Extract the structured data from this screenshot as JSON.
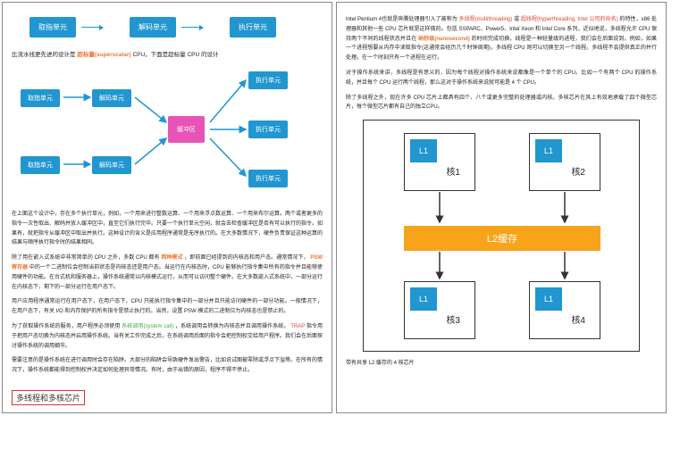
{
  "left": {
    "pipe": {
      "u1": "取指单元",
      "u2": "解码单元",
      "u3": "执行单元"
    },
    "cap1_a": "比流水线更先进的设计是",
    "cap1_b": "超标量(superscalar)",
    "cap1_c": " CPU。下面是超标量 CPU 的设计",
    "ss": {
      "fetch": "取指单元",
      "decode": "解码单元",
      "buffer": "缓冲区",
      "exec": "执行单元"
    },
    "p1": "在上面这个设计中，存在多个执行单元，例如，一个用来进行整数运算、一个用来浮点数运算、一个用来布尔运算。两个或者更多的指令一次性取出、解码并放入缓冲区中，直至它们执行完毕。只要一个执行单元空闲，就会去检查缓冲区是否有可以执行的指令。如果有，就把指令从缓冲区中取出并执行。这种设计的含义是应用程序通常是无序执行的。在大多数情况下，硬件负责保证这种运算的结果与顺序执行指令时的结果相同。",
    "p2a": "除了用在嵌入式系统中非常简单的 CPU 之外，多数 CPU 都有",
    "p2h": "两种模式",
    "p2b": "，即前面已经提到的内核态和用户态。通常情况下，",
    "p2h2": "PSW 寄存器",
    "p2c": "中的一个二进制位会控制当前状态是内核态还是用户态。当运行在内核态时，CPU 能够执行指令集中所有的指令并且能够使用硬件的功能。在台式机和服务器上，操作系统通常以内核模式运行，从而可以访问整个硬件。在大多数嵌入式系统中，一部分运行在内核态下，剩下的一部分运行在用户态下。",
    "p3": "用户应用程序通常运行在用户态下，在用户态下，CPU 只能执行指令集中的一部分并且只能访问硬件的一部分功能。一般情况下，在用户态下，有关 I/O 和内存保护的所有指令是禁止执行的。当然，设置 PSW 模式的二进制位为内核态也是禁止的。",
    "p4a": "为了获取操作系统的服务，用户程序必须使用",
    "p4h": "系统调用(system call)",
    "p4b": "，系统调用会转换为内核态并且调用操作系统。",
    "p4h2": "TRAP",
    "p4c": " 指令用于把用户态切换为内核态并启用操作系统。当有关工作完成之后，在系统调用后面的指令会把控制权交给用户程序。我们会在后面探讨操作系统的调用细节。",
    "p5": "需要注意的是操作系统在进行调用时会存在陷阱。大部分的陷阱会导致硬件发出警告，比如说试图被零除或浮点下溢等。在所有的情况下，操作系统都能得到控制权并决定如何处理异常情况。有时，由于出错的原因，程序不得不停止。",
    "section": "多线程和多核芯片"
  },
  "right": {
    "p1a": "Intel Pentium 4也就是奔腾处理器引入了被称为",
    "p1h1": "多线程(multithreading)",
    "p1b": " 或 ",
    "p1h2": "超线程(hyperthreading, Intel 公司的命名)",
    "p1c": " 的特性，x86 处理器和其他一些 CPU 芯片就是这样做的。包括 SSPARC、Power5、Intel Xeon 和 Intel Core 系列，近似地说，多线程允许 CPU 保持两个不同的线程状态并且在",
    "p1h3": "纳秒级(nanosecond)",
    "p1d": " 的时间完成切换。线程是一种轻量级的进程，我们会在后面说到。例如，如果一个进程想要从内存中读取指令(这通常会经历几个时钟周期)，多线程 CPU 则可以切换至另一个线程。多线程不会提供真正的并行处理。在一个时刻只有一个进程在运行。",
    "p2": "对于操作系统来讲，多线程是有意义的，因为每个线程对操作系统来说都像是一个单个的 CPU。比如一个有两个 CPU 的操作系统，并且每个 CPU 运行两个线程，那么这对于操作系统来说就可能是 4 个 CPU。",
    "p3": "除了多线程之外，现在许多 CPU 芯片上都具有四个、八个或更多完整的处理器或内核。多核芯片在其上有效地承载了四个微型芯片，每个微型芯片都有自己的独立CPU。",
    "mc": {
      "l1": "L1",
      "core1": "核1",
      "core2": "核2",
      "core3": "核3",
      "core4": "核4",
      "l2": "L2缓存"
    },
    "mc_cap": "带有共享 L2 缓存的 4 核芯片"
  }
}
